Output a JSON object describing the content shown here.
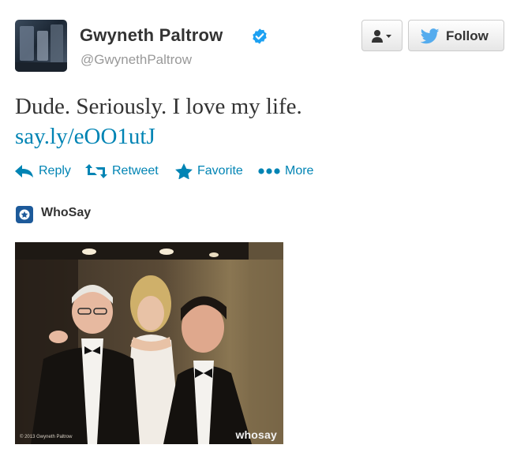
{
  "user": {
    "name": "Gwyneth Paltrow",
    "handle": "@GwynethPaltrow",
    "verified": true
  },
  "buttons": {
    "user_actions_icon": "user-dropdown-icon",
    "follow_label": "Follow"
  },
  "tweet": {
    "text": "Dude. Seriously. I love my life.",
    "link": "say.ly/eOO1utJ"
  },
  "actions": {
    "reply": "Reply",
    "retweet": "Retweet",
    "favorite": "Favorite",
    "more": "More"
  },
  "card": {
    "source": "WhoSay"
  },
  "photo": {
    "credit": "© 2013 Gwyneth Paltrow",
    "watermark": "whosay"
  },
  "colors": {
    "link": "#0084b4",
    "text": "#333333",
    "muted": "#999999",
    "verified": "#1da1f2",
    "twitter_bird": "#55acee",
    "whosay_brand": "#1d5a9a"
  }
}
